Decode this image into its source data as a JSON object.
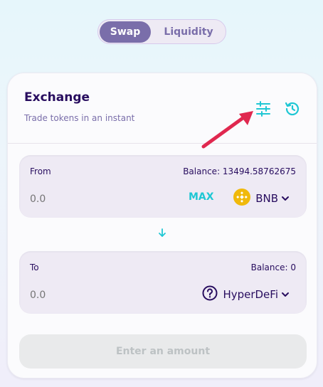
{
  "tabs": {
    "swap": "Swap",
    "liquidity": "Liquidity"
  },
  "card": {
    "title": "Exchange",
    "subtitle": "Trade tokens in an instant"
  },
  "from": {
    "label": "From",
    "balance": "Balance: 13494.58762675",
    "placeholder": "0.0",
    "max_label": "MAX",
    "token": "BNB",
    "token_icon": "bnb-icon"
  },
  "to": {
    "label": "To",
    "balance": "Balance: 0",
    "placeholder": "0.0",
    "token": "HyperDeFi",
    "token_icon": "unknown-token-icon"
  },
  "action_button": "Enter an amount",
  "colors": {
    "primary": "#7a6eaa",
    "accent": "#1fc7d4",
    "text": "#280d5f",
    "annotation_arrow": "#e0284f"
  }
}
